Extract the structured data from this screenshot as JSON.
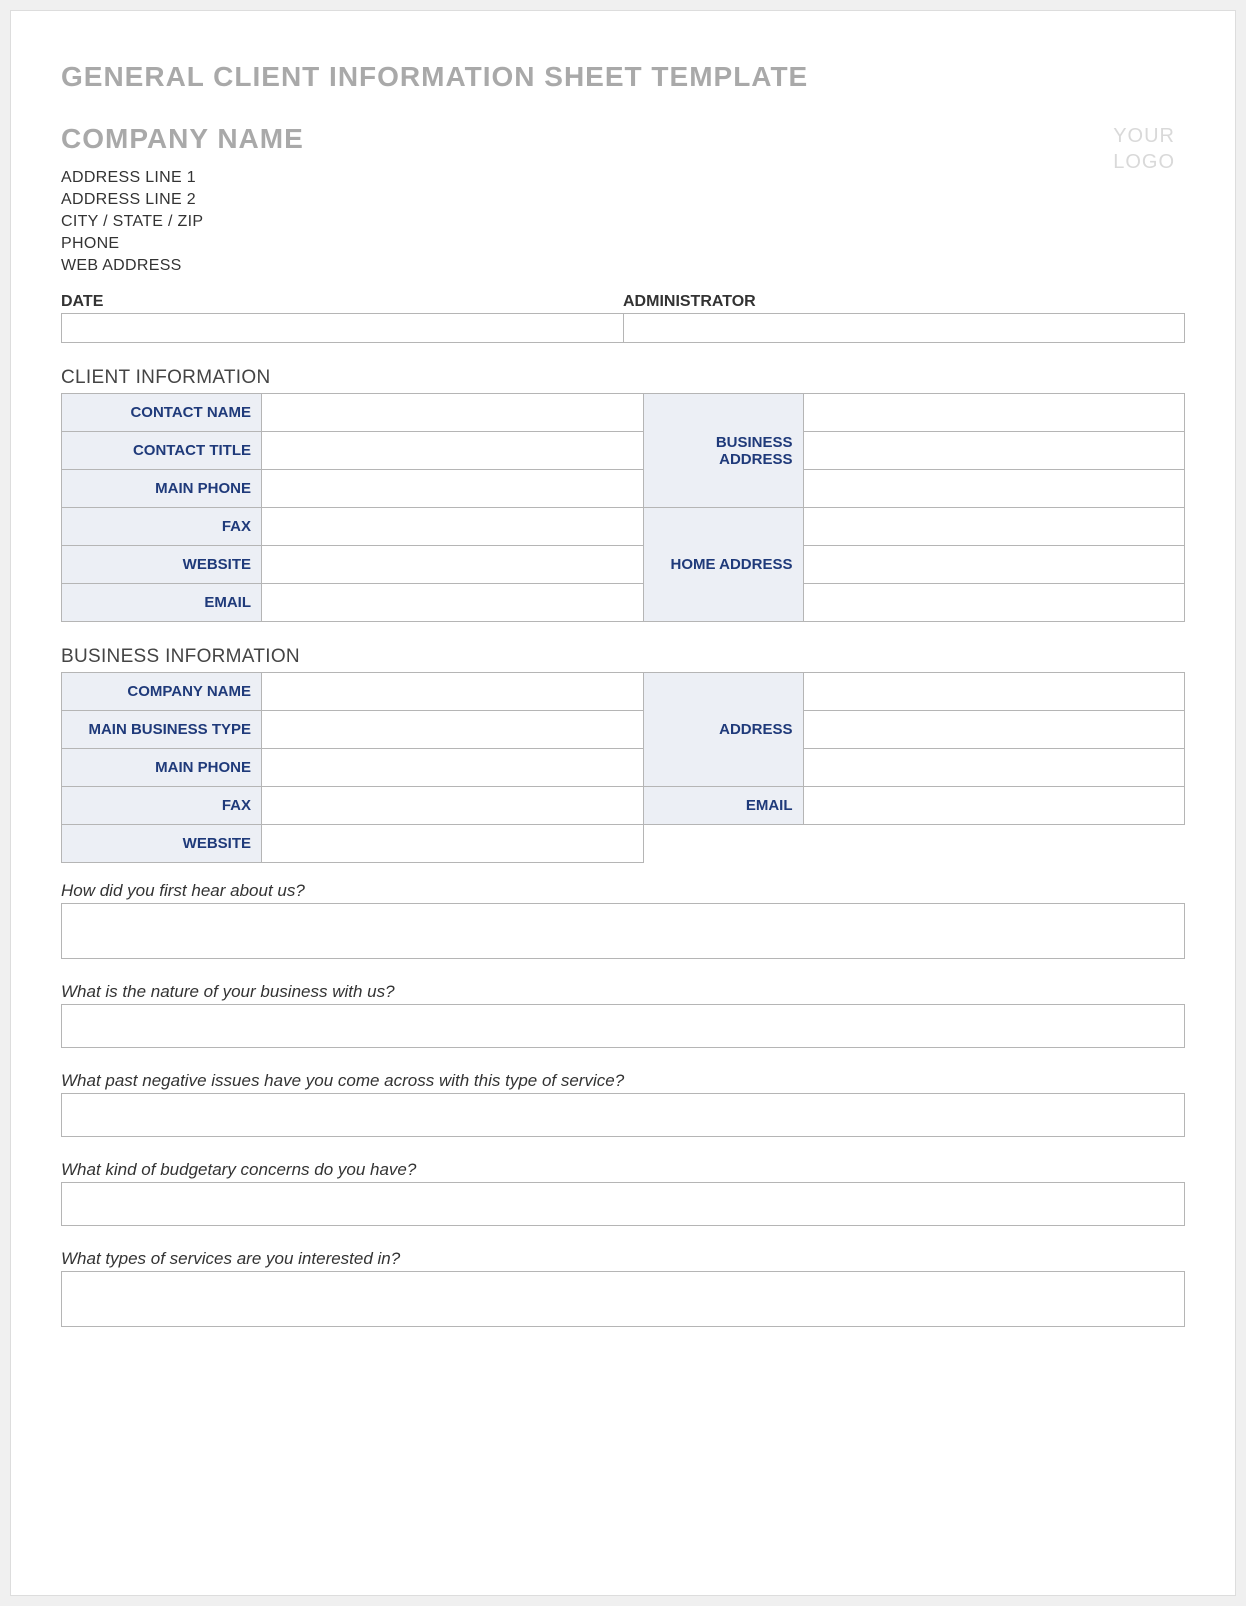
{
  "doc_title": "GENERAL CLIENT INFORMATION SHEET TEMPLATE",
  "company": {
    "name": "COMPANY NAME",
    "address1": "ADDRESS LINE 1",
    "address2": "ADDRESS LINE 2",
    "city_state_zip": "CITY / STATE / ZIP",
    "phone": "PHONE",
    "web": "WEB ADDRESS"
  },
  "logo_text_line1": "YOUR",
  "logo_text_line2": "LOGO",
  "date_admin": {
    "date_label": "DATE",
    "admin_label": "ADMINISTRATOR",
    "date_value": "",
    "admin_value": ""
  },
  "client_info": {
    "section_title": "CLIENT INFORMATION",
    "contact_name_label": "CONTACT NAME",
    "contact_title_label": "CONTACT TITLE",
    "main_phone_label": "MAIN PHONE",
    "fax_label": "FAX",
    "website_label": "WEBSITE",
    "email_label": "EMAIL",
    "business_address_label": "BUSINESS ADDRESS",
    "home_address_label": "HOME ADDRESS",
    "contact_name": "",
    "contact_title": "",
    "main_phone": "",
    "fax": "",
    "website": "",
    "email": "",
    "business_address_1": "",
    "business_address_2": "",
    "business_address_3": "",
    "home_address_1": "",
    "home_address_2": "",
    "home_address_3": ""
  },
  "business_info": {
    "section_title": "BUSINESS INFORMATION",
    "company_name_label": "COMPANY NAME",
    "main_business_type_label": "MAIN BUSINESS TYPE",
    "main_phone_label": "MAIN PHONE",
    "fax_label": "FAX",
    "website_label": "WEBSITE",
    "address_label": "ADDRESS",
    "email_label": "EMAIL",
    "company_name": "",
    "main_business_type": "",
    "main_phone": "",
    "fax": "",
    "website": "",
    "address_1": "",
    "address_2": "",
    "address_3": "",
    "email": ""
  },
  "questions": {
    "q1": "How did you first hear about us?",
    "q2": "What is the nature of your business with us?",
    "q3": "What past negative issues have you come across with this type of service?",
    "q4": "What kind of budgetary concerns do you have?",
    "q5": "What types of services are you interested in?",
    "a1": "",
    "a2": "",
    "a3": "",
    "a4": "",
    "a5": ""
  }
}
